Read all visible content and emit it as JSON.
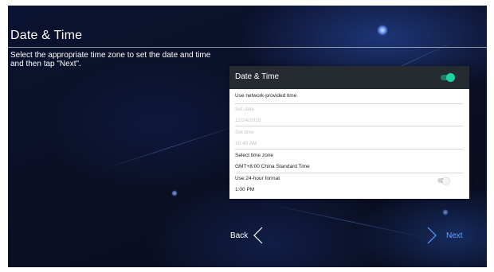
{
  "page": {
    "title": "Date & Time",
    "instructions": "Select the appropriate time zone to set the date and time and then tap \"Next\"."
  },
  "dialog": {
    "title": "Date & Time",
    "header_toggle_on": true,
    "network_time_label": "Use network-provided time",
    "set_date_label": "Set date",
    "set_date_value": "12/24/2019",
    "set_time_label": "Set time",
    "set_time_value": "10:49 AM",
    "time_zone_label": "Select time zone",
    "time_zone_value": "GMT+8:00 China Standard Time",
    "format_24h_label": "Use 24-hour format",
    "format_24h_on": false,
    "format_sample": "1:00 PM"
  },
  "navigation": {
    "back_label": "Back",
    "next_label": "Next"
  },
  "colors": {
    "accent_toggle": "#1ed3a3",
    "next_text": "#5fa3ff",
    "dialog_header": "#262b31"
  },
  "icons": {
    "back": "chevron-left-icon",
    "next": "chevron-right-icon"
  }
}
